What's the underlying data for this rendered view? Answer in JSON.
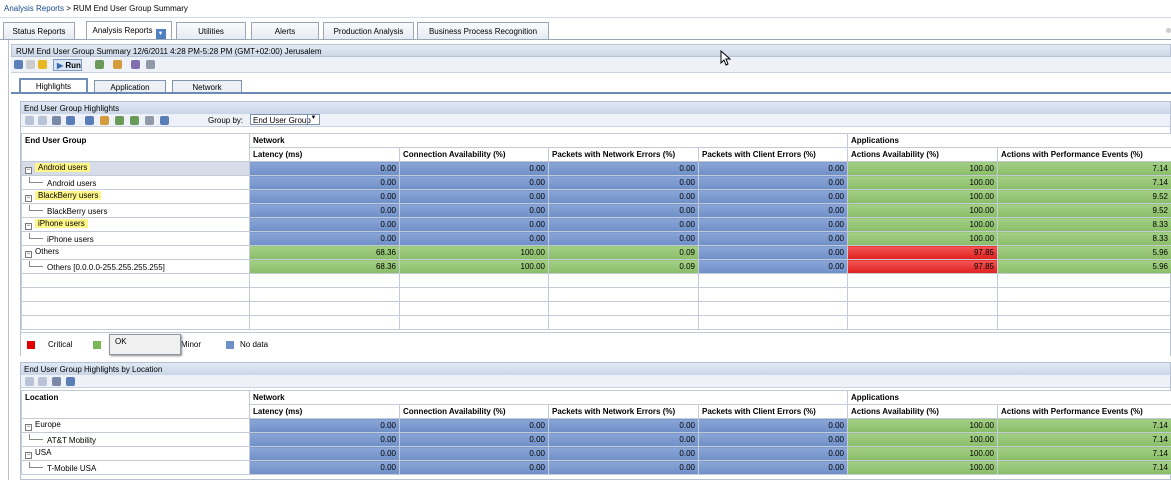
{
  "breadcrumb": {
    "parent": "Analysis Reports",
    "separator": " > ",
    "current": "RUM End User Group Summary"
  },
  "top_tabs": [
    {
      "label": "Status Reports"
    },
    {
      "label": "Analysis Reports"
    },
    {
      "label": "Utilities"
    },
    {
      "label": "Alerts"
    },
    {
      "label": "Production Analysis"
    },
    {
      "label": "Business Process Recognition"
    }
  ],
  "report_title": "RUM End User Group Summary 12/6/2011 4:28 PM-5:28 PM (GMT+02:00) Jerusalem",
  "toolbar": {
    "run_label": "Run"
  },
  "sub_tabs": [
    {
      "label": "Highlights"
    },
    {
      "label": "Application"
    },
    {
      "label": "Network"
    }
  ],
  "panel1": {
    "title": "End User Group Highlights",
    "group_by_label": "Group by:",
    "group_by_value": "End User Group",
    "first_col_header": "End User Group",
    "group_headers": {
      "network": "Network",
      "applications": "Applications"
    },
    "columns": [
      "Latency (ms)",
      "Connection Availability (%)",
      "Packets with Network Errors (%)",
      "Packets with Client Errors (%)",
      "Actions Availability (%)",
      "Actions with Performance Events (%)"
    ],
    "rows": [
      {
        "label": "Android users",
        "values": [
          "0.00",
          "0.00",
          "0.00",
          "0.00",
          "100.00",
          "7.14"
        ]
      },
      {
        "label": "Android users",
        "values": [
          "0.00",
          "0.00",
          "0.00",
          "0.00",
          "100.00",
          "7.14"
        ]
      },
      {
        "label": "BlackBerry users",
        "values": [
          "0.00",
          "0.00",
          "0.00",
          "0.00",
          "100.00",
          "9.52"
        ]
      },
      {
        "label": "BlackBerry users",
        "values": [
          "0.00",
          "0.00",
          "0.00",
          "0.00",
          "100.00",
          "9.52"
        ]
      },
      {
        "label": "iPhone users",
        "values": [
          "0.00",
          "0.00",
          "0.00",
          "0.00",
          "100.00",
          "8.33"
        ]
      },
      {
        "label": "iPhone users",
        "values": [
          "0.00",
          "0.00",
          "0.00",
          "0.00",
          "100.00",
          "8.33"
        ]
      },
      {
        "label": "Others",
        "values": [
          "68.36",
          "100.00",
          "0.09",
          "0.00",
          "97.85",
          "5.96"
        ]
      },
      {
        "label": "Others [0.0.0.0-255.255.255.255]",
        "values": [
          "68.36",
          "100.00",
          "0.09",
          "0.00",
          "97.85",
          "5.96"
        ]
      }
    ]
  },
  "legend": {
    "critical": "Critical",
    "ok_popup": "OK",
    "minor": "Minor",
    "no_data": "No data"
  },
  "panel2": {
    "title": "End User Group Highlights by Location",
    "first_col_header": "Location",
    "rows": [
      {
        "label": "Europe",
        "values": [
          "0.00",
          "0.00",
          "0.00",
          "0.00",
          "100.00",
          "7.14"
        ]
      },
      {
        "label": "AT&T Mobility",
        "values": [
          "0.00",
          "0.00",
          "0.00",
          "0.00",
          "100.00",
          "7.14"
        ]
      },
      {
        "label": "USA",
        "values": [
          "0.00",
          "0.00",
          "0.00",
          "0.00",
          "100.00",
          "7.14"
        ]
      },
      {
        "label": "T-Mobile USA",
        "values": [
          "0.00",
          "0.00",
          "0.00",
          "0.00",
          "100.00",
          "7.14"
        ]
      }
    ]
  },
  "colors": {
    "blue": "#7b99cf",
    "green": "#92c572",
    "red": "#e83333",
    "highlight": "#fff68a"
  },
  "icons": [
    "filter-icon",
    "star-icon",
    "run-icon",
    "export-icon",
    "user-icon",
    "tree-expand-icon",
    "tree-collapse-icon",
    "expand-all-icon",
    "collapse-all-icon",
    "mouse-cursor-icon"
  ]
}
